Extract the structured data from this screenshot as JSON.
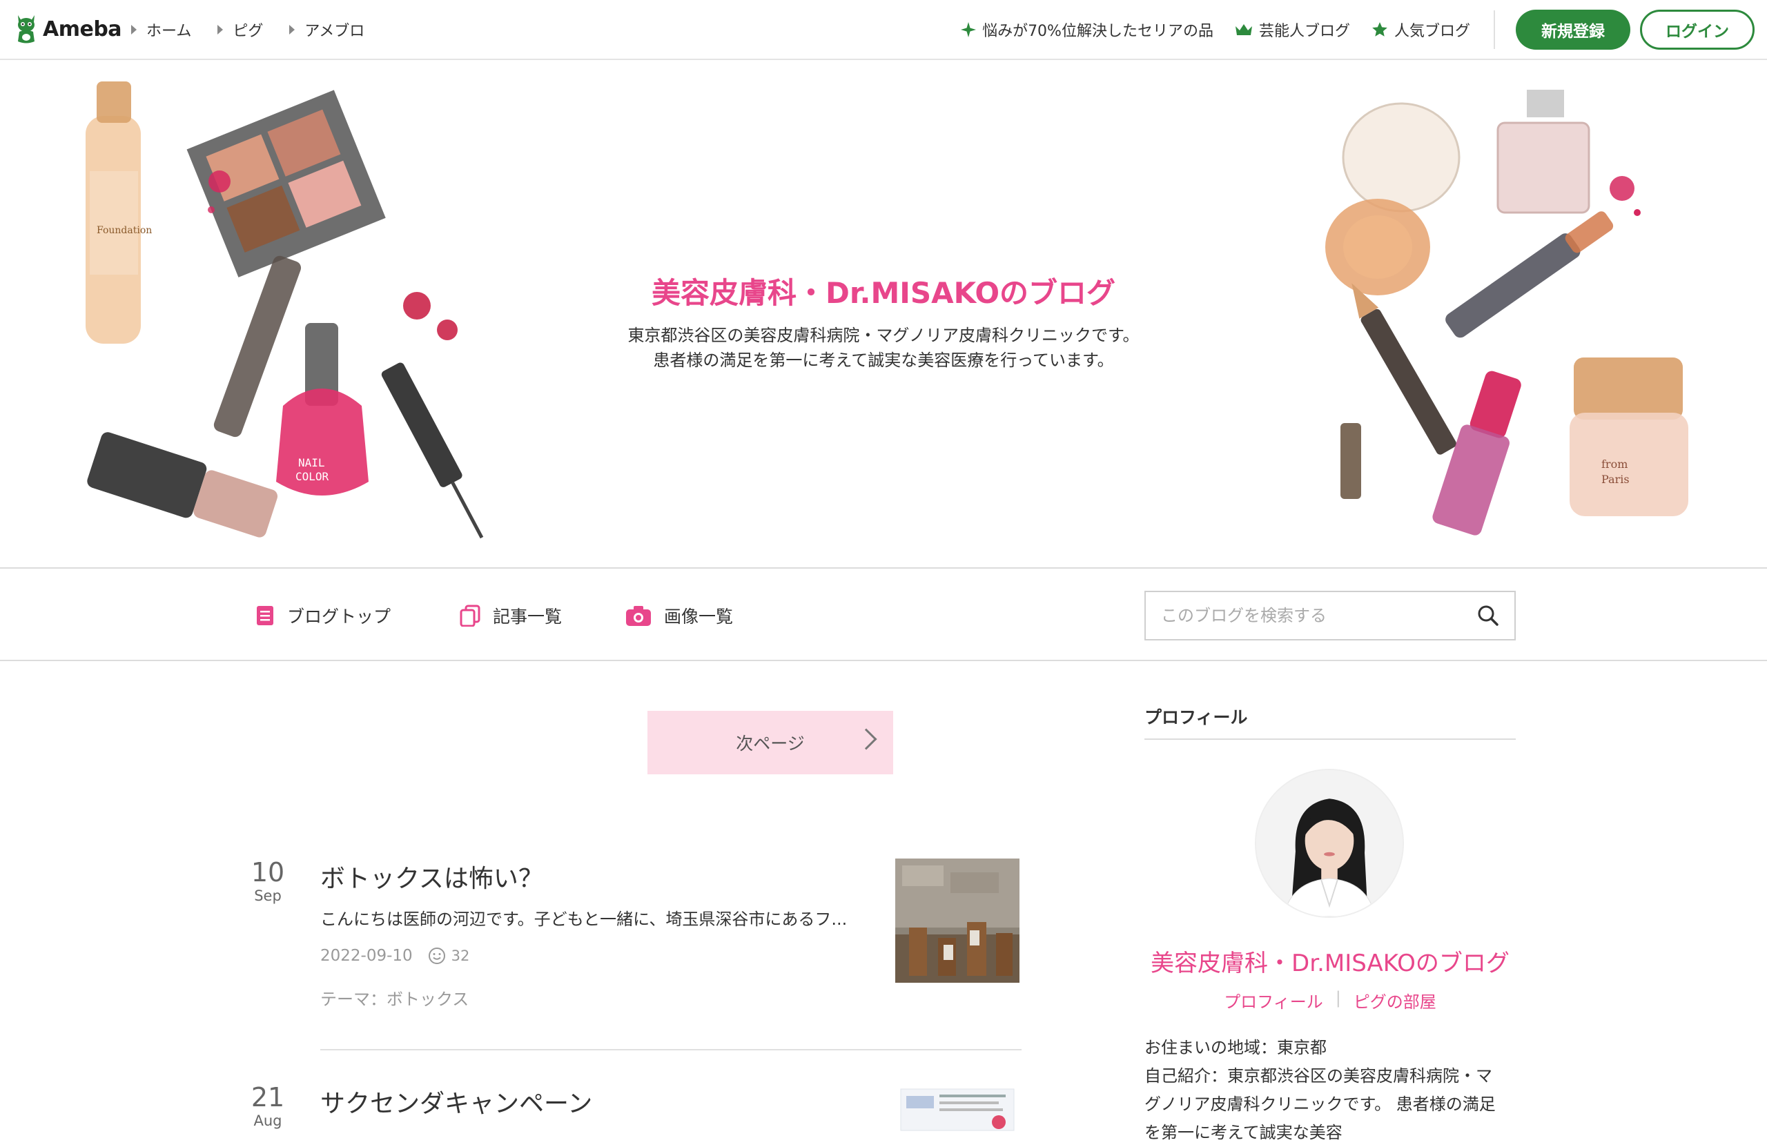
{
  "topbar": {
    "logo_text": "Ameba",
    "crumbs": [
      "ホーム",
      "ピグ",
      "アメブロ"
    ],
    "links": [
      {
        "label": "悩みが70%位解決したセリアの品",
        "icon": "sparkle-icon"
      },
      {
        "label": "芸能人ブログ",
        "icon": "crown-icon"
      },
      {
        "label": "人気ブログ",
        "icon": "star-icon"
      }
    ],
    "register_label": "新規登録",
    "login_label": "ログイン",
    "brand_color": "#2d8a3d"
  },
  "header": {
    "title": "美容皮膚科・Dr.MISAKOのブログ",
    "desc_line1": "東京都渋谷区の美容皮膚科病院・マグノリア皮膚科クリニックです。",
    "desc_line2": "患者様の満足を第一に考えて誠実な美容医療を行っています。",
    "accent_color": "#e8468b"
  },
  "nav": {
    "items": [
      {
        "label": "ブログトップ",
        "icon": "blog-top-icon"
      },
      {
        "label": "記事一覧",
        "icon": "article-list-icon"
      },
      {
        "label": "画像一覧",
        "icon": "camera-icon"
      }
    ],
    "search_placeholder": "このブログを検索する"
  },
  "main": {
    "next_page_label": "次ページ",
    "entries": [
      {
        "day": "10",
        "month": "Sep",
        "title": "ボトックスは怖い？",
        "excerpt": "こんにちは医師の河辺です。子どもと一緒に、埼玉県深谷市にあるフ...",
        "date": "2022-09-10",
        "likes": "32",
        "theme": "テーマ：ボトックス"
      },
      {
        "day": "21",
        "month": "Aug",
        "title": "サクセンダキャンペーン"
      }
    ]
  },
  "sidebar": {
    "heading": "プロフィール",
    "name": "美容皮膚科・Dr.MISAKOのブログ",
    "link_profile": "プロフィール",
    "link_room": "ピグの部屋",
    "residence": "お住まいの地域：東京都",
    "intro_1": "自己紹介：東京都渋谷区の美容皮膚科病院・マ",
    "intro_2": "グノリア皮膚科クリニックです。 患者様の満足",
    "intro_3": "を第一に考えて誠実な美容"
  }
}
